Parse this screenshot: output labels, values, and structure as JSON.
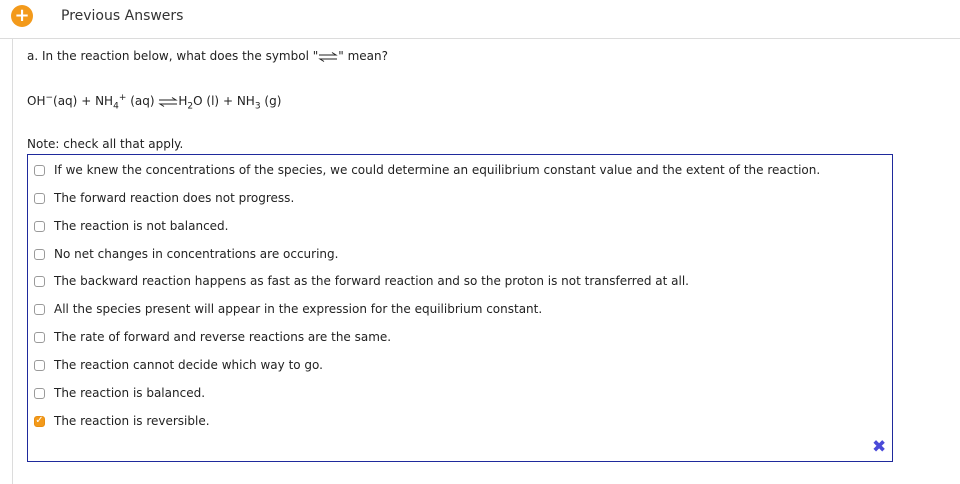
{
  "header": {
    "title": "Previous Answers",
    "plus_icon": "+"
  },
  "question": {
    "prefix": "a. In the reaction below, what does the symbol \"",
    "suffix": "\" mean?"
  },
  "equation": {
    "r1": "OH",
    "r1_sup": "−",
    "r1_state": "(aq)",
    "plus1": "+",
    "r2": "NH",
    "r2_sub": "4",
    "r2_sup": "+",
    "r2_state": "(aq)",
    "p1a": "H",
    "p1_sub": "2",
    "p1b": "O",
    "p1_state": "(l)",
    "plus2": "+",
    "p2": "NH",
    "p2_sub": "3",
    "p2_state": "(g)"
  },
  "note": "Note: check all that apply.",
  "options": [
    {
      "label": "If we knew the concentrations of the species, we could determine an equilibrium constant value and the extent of the reaction.",
      "checked": false
    },
    {
      "label": "The forward reaction does not progress.",
      "checked": false
    },
    {
      "label": "The reaction is not balanced.",
      "checked": false
    },
    {
      "label": "No net changes in concentrations are occuring.",
      "checked": false
    },
    {
      "label": "The backward reaction happens as fast as the forward reaction and so the proton is not transferred at all.",
      "checked": false
    },
    {
      "label": "All the species present will appear in the expression for the equilibrium constant.",
      "checked": false
    },
    {
      "label": "The rate of forward and reverse reactions are the same.",
      "checked": false
    },
    {
      "label": "The reaction cannot decide which way to go.",
      "checked": false
    },
    {
      "label": "The reaction is balanced.",
      "checked": false
    },
    {
      "label": "The reaction is reversible.",
      "checked": true,
      "checkmark": "✓"
    }
  ],
  "result_icon": "✖",
  "colors": {
    "accent": "#f39a1b",
    "box_border": "#1f2a9c",
    "x_mark": "#4a4ad8"
  }
}
